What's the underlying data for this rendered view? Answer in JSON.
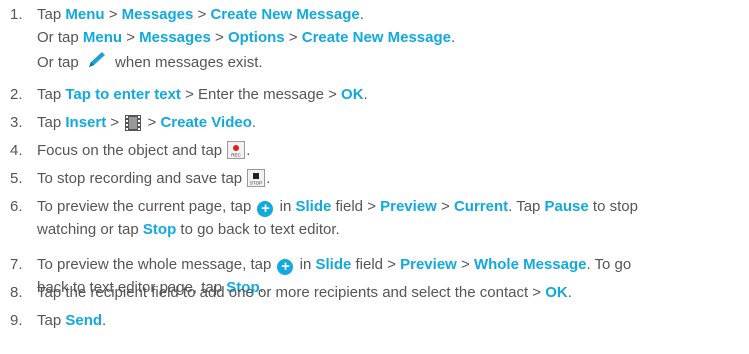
{
  "steps": [
    {
      "num": "1.",
      "lines": [
        [
          "Tap ",
          {
            "kw": "Menu"
          },
          " > ",
          {
            "kw": "Messages"
          },
          " > ",
          {
            "kw": "Create New Message"
          },
          "."
        ],
        [
          "Or tap ",
          {
            "kw": "Menu"
          },
          " > ",
          {
            "kw": "Messages"
          },
          " > ",
          {
            "kw": "Options"
          },
          " > ",
          {
            "kw": "Create New Message"
          },
          "."
        ],
        [
          "Or tap ",
          {
            "icon": "pencil-icon"
          },
          " when messages exist."
        ]
      ]
    },
    {
      "num": "2.",
      "lines": [
        [
          "Tap ",
          {
            "kw": "Tap to enter text"
          },
          " > Enter the message > ",
          {
            "kw": "OK"
          },
          "."
        ]
      ]
    },
    {
      "num": "3.",
      "lines": [
        [
          "Tap ",
          {
            "kw": "Insert"
          },
          " > ",
          {
            "icon": "film-icon"
          },
          " > ",
          {
            "kw": "Create Video"
          },
          "."
        ]
      ]
    },
    {
      "num": "4.",
      "lines": [
        [
          "Focus on the object and tap ",
          {
            "icon": "rec-icon"
          },
          "."
        ]
      ]
    },
    {
      "num": "5.",
      "lines": [
        [
          "To stop recording and save tap ",
          {
            "icon": "stop-icon"
          },
          "."
        ]
      ]
    },
    {
      "num": "6.",
      "lines": [
        [
          "To preview the current page, tap ",
          {
            "icon": "plus-icon"
          },
          " in ",
          {
            "kw": "Slide"
          },
          " field > ",
          {
            "kw": "Preview"
          },
          " > ",
          {
            "kw": "Current"
          },
          ". Tap ",
          {
            "kw": "Pause"
          },
          " to stop"
        ],
        [
          "watching or tap ",
          {
            "kw": "Stop"
          },
          " to go back to text editor."
        ]
      ]
    },
    {
      "num": "7.",
      "lines": [
        [
          "To preview the whole message, tap ",
          {
            "icon": "plus-icon"
          },
          " in ",
          {
            "kw": "Slide"
          },
          " field > ",
          {
            "kw": "Preview"
          },
          " > ",
          {
            "kw": "Whole Message"
          },
          ". To go"
        ],
        [
          "back to text editor page, tap ",
          {
            "kw": "Stop"
          },
          "."
        ]
      ]
    },
    {
      "num": "8.",
      "lines": [
        [
          "Tap the recipient field to add one or more recipients and select the contact > ",
          {
            "kw": "OK"
          },
          "."
        ]
      ]
    },
    {
      "num": "9.",
      "lines": [
        [
          "Tap ",
          {
            "kw": "Send"
          },
          "."
        ]
      ]
    }
  ],
  "icon_labels": {
    "rec": "REC",
    "stop": "STOP"
  },
  "colors": {
    "keyword": "#11a9de",
    "body_text": "#555555"
  }
}
